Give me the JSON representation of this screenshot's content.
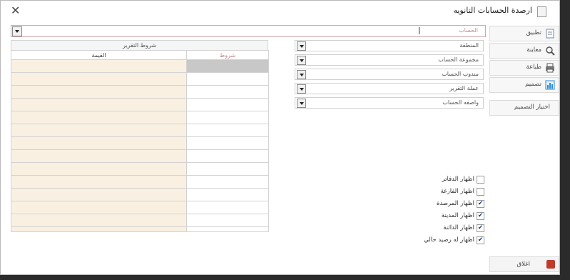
{
  "window": {
    "title": "ارصدة الحسابات التانويه"
  },
  "account_field": {
    "label": "الحساب"
  },
  "side_buttons": [
    {
      "label": "تطبيق",
      "icon": "apply-icon"
    },
    {
      "label": "معاينة",
      "icon": "preview-search-icon"
    },
    {
      "label": "طباعة",
      "icon": "printer-icon"
    },
    {
      "label": "تصميم",
      "icon": "design-chart-icon"
    },
    {
      "label": "اختيار التصميم"
    }
  ],
  "conditions": {
    "title": "شروط التقرير",
    "col_value": "القيمة",
    "col_condition": "شروط",
    "row_count": 14
  },
  "filters": [
    {
      "label": "المنطقة"
    },
    {
      "label": "مجموعة الحساب"
    },
    {
      "label": "مندوب الحساب"
    },
    {
      "label": "عملة التقرير"
    },
    {
      "label": "واصفه الحساب"
    }
  ],
  "checkboxes": [
    {
      "label": "اظهار الدفاتر",
      "checked": false
    },
    {
      "label": "اظهار الفارغة",
      "checked": false
    },
    {
      "label": "اظهار المرصدة",
      "checked": true
    },
    {
      "label": "اظهار المدينة",
      "checked": true
    },
    {
      "label": "اظهار الدائنة",
      "checked": true
    },
    {
      "label": "اظهار له رصيد حالي",
      "checked": true
    }
  ],
  "close_button": {
    "label": "اغلاق"
  }
}
